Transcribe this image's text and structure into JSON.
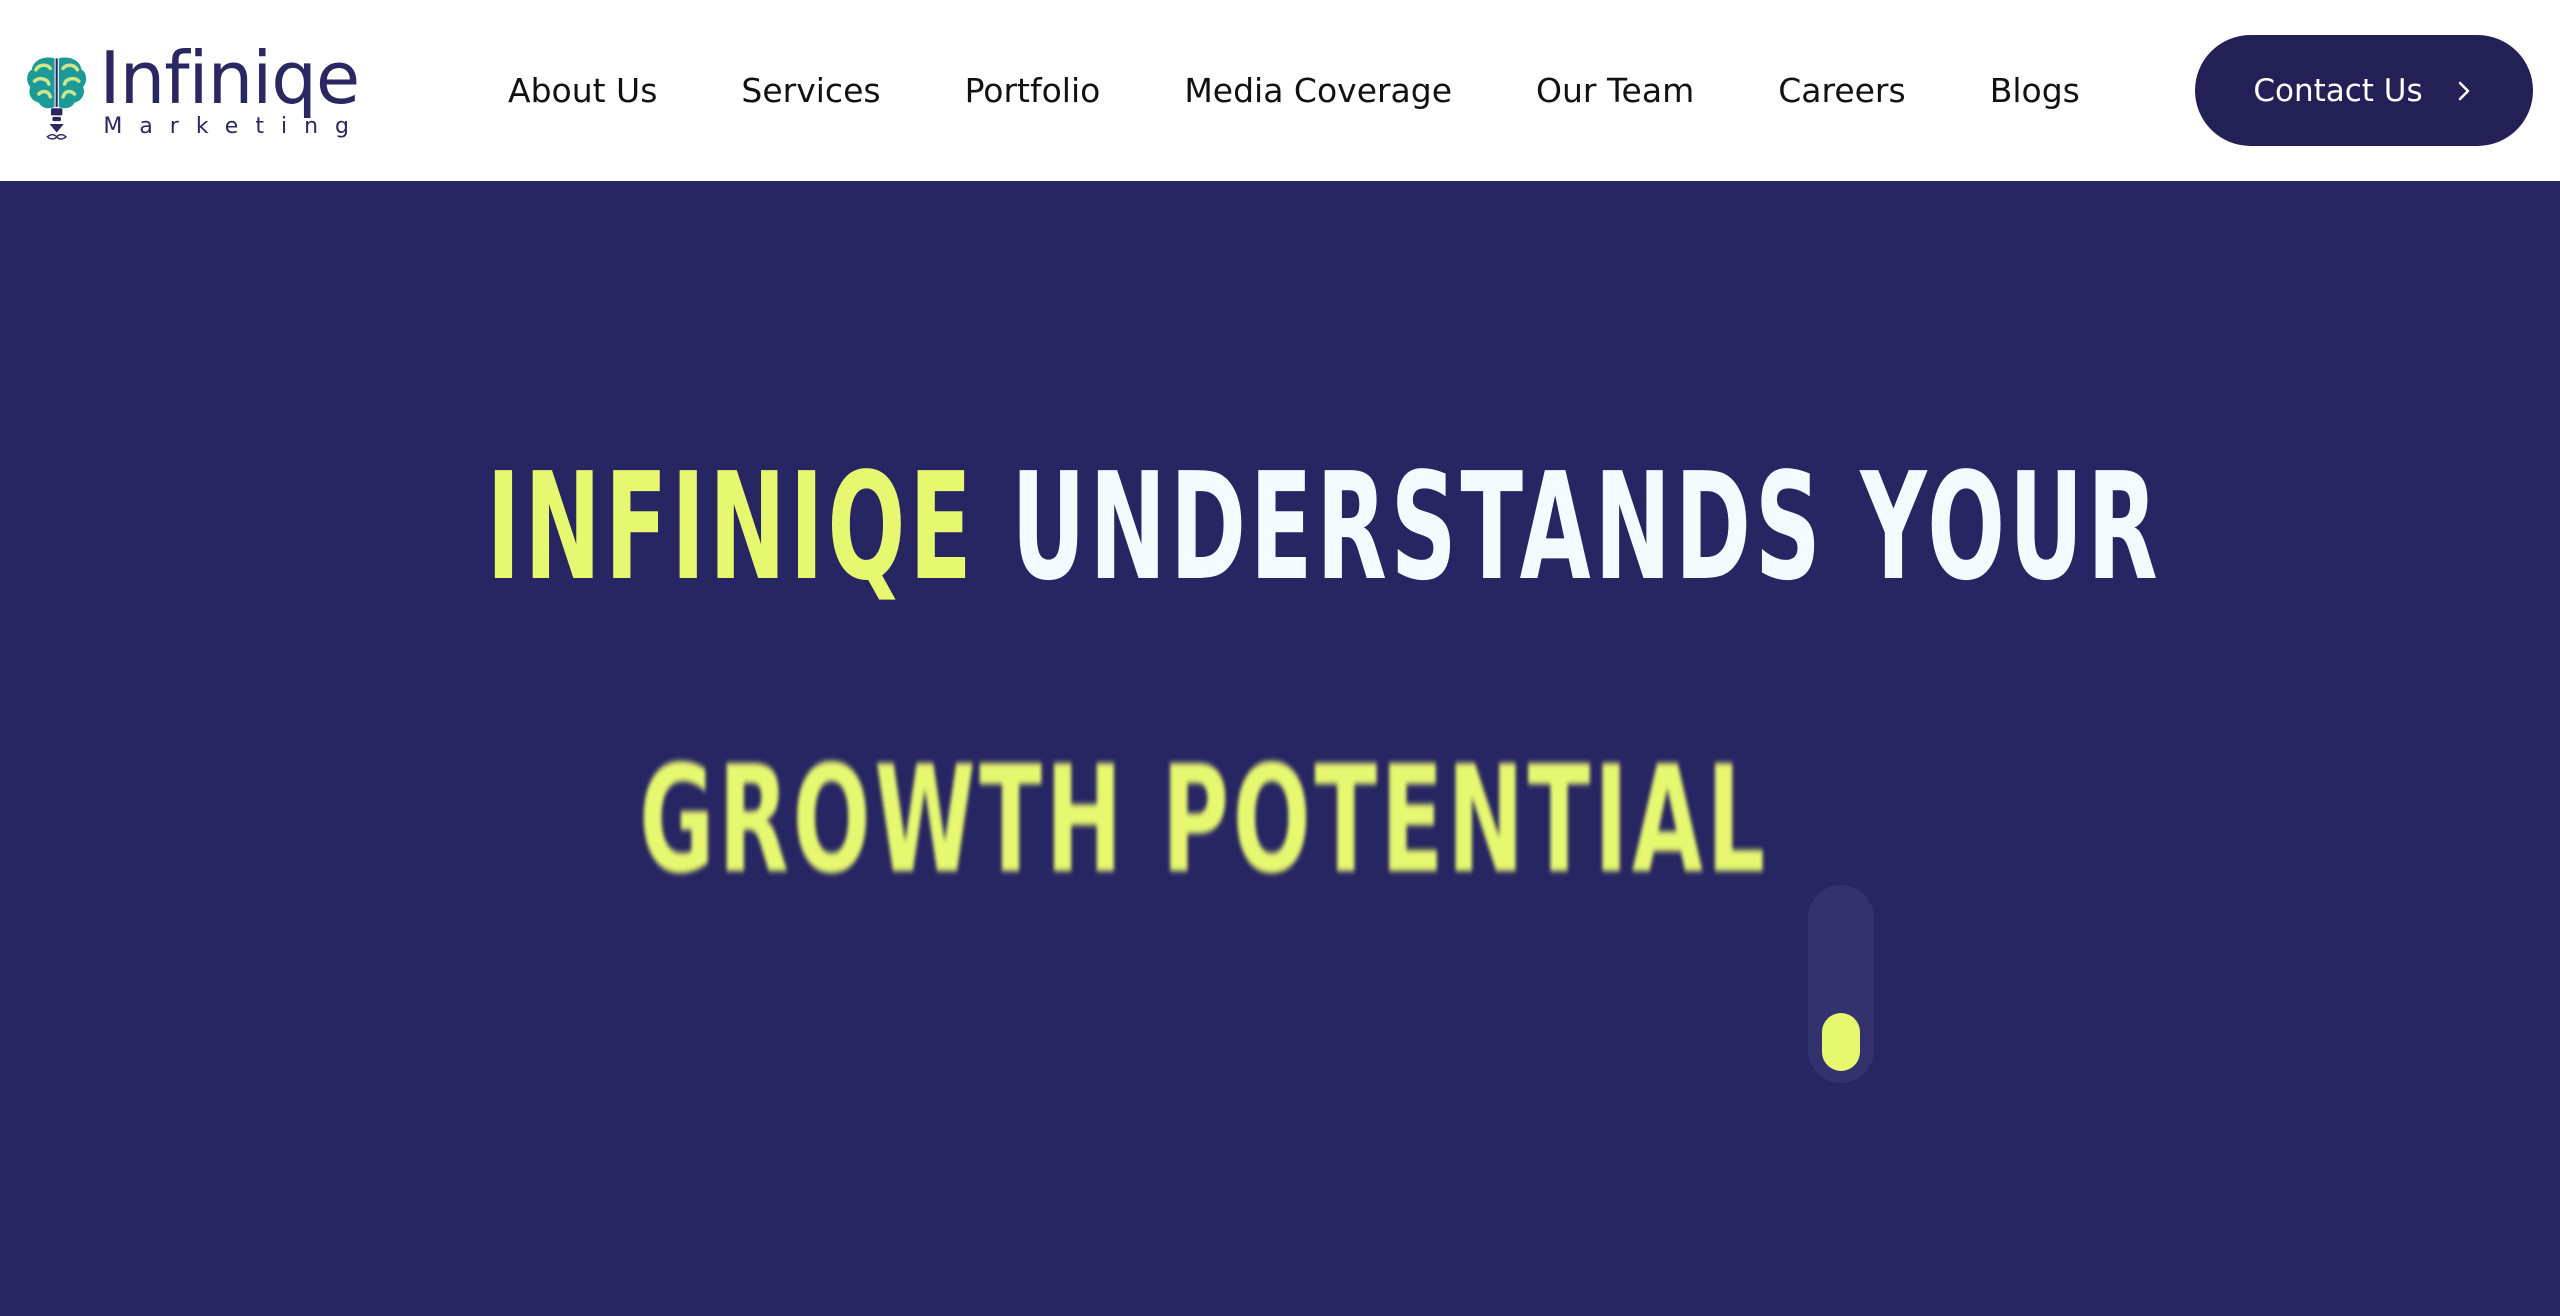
{
  "brand": {
    "name": "Infiniqe",
    "tagline": "Marketing",
    "colors": {
      "navy": "#232055",
      "hero_bg": "#282563",
      "accent": "#e6f86f",
      "teal": "#1c9a98"
    },
    "logo_icon": "brain-bulb-icon"
  },
  "nav": {
    "items": [
      {
        "label": "About Us"
      },
      {
        "label": "Services"
      },
      {
        "label": "Portfolio"
      },
      {
        "label": "Media Coverage"
      },
      {
        "label": "Our Team"
      },
      {
        "label": "Careers"
      },
      {
        "label": "Blogs"
      }
    ],
    "cta_label": "Contact Us",
    "cta_icon": "chevron-right-icon"
  },
  "hero": {
    "headline_accent": "INFINIQE",
    "headline_rest": "UNDERSTANDS YOUR",
    "headline_line2": "GROWTH POTENTIAL",
    "scroll_icon": "scroll-indicator-icon"
  }
}
